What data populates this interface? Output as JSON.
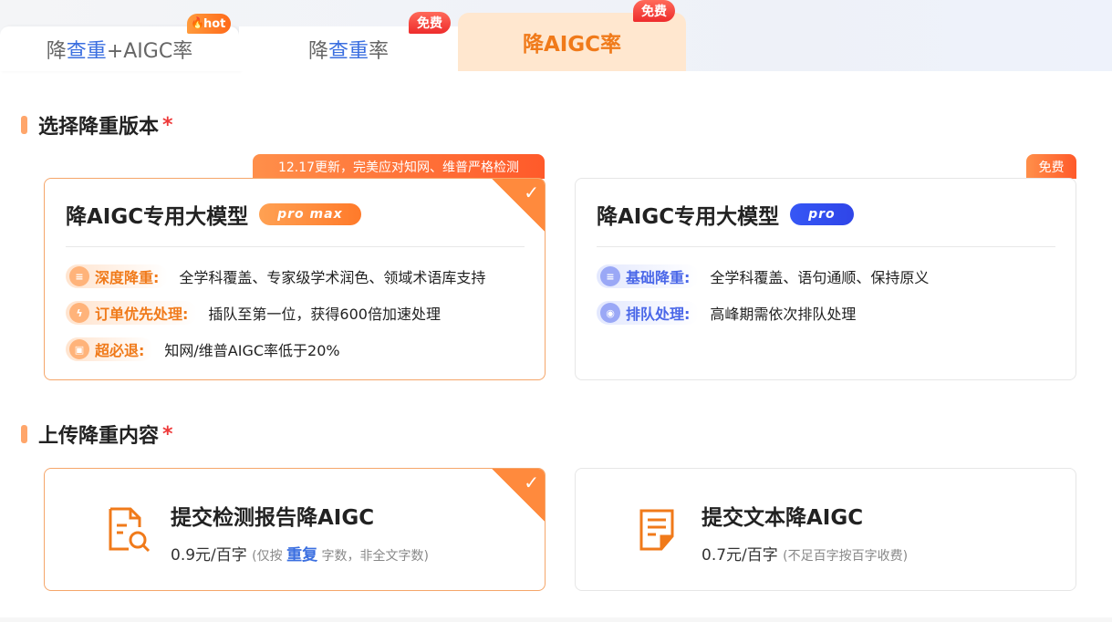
{
  "tabs": {
    "t1": {
      "p1": "降",
      "p2": "查重",
      "p3": "+AIGC率",
      "badge": "hot"
    },
    "t2": {
      "p1": "降",
      "p2": "查重",
      "p3": "率",
      "badge": "免费"
    },
    "t3": {
      "label": "降AIGC率",
      "badge": "免费"
    }
  },
  "section_version": {
    "title": "选择降重版本",
    "star": "*"
  },
  "card_promax": {
    "ribbon": "12.17更新，完美应对知网、维普严格检测",
    "title": "降AIGC专用大模型",
    "pill": "pro max",
    "features": [
      {
        "label": "深度降重:",
        "desc": "全学科覆盖、专家级学术润色、领域术语库支持",
        "icon": "layers-icon"
      },
      {
        "label": "订单优先处理:",
        "desc": "插队至第一位，获得600倍加速处理",
        "icon": "lightning-icon"
      },
      {
        "label": "超必退:",
        "desc": "知网/维普AIGC率低于20%",
        "icon": "wallet-icon"
      }
    ]
  },
  "card_pro": {
    "ribbon": "免费",
    "title": "降AIGC专用大模型",
    "pill": "pro",
    "features": [
      {
        "label": "基础降重:",
        "desc": "全学科覆盖、语句通顺、保持原义",
        "icon": "layers-icon"
      },
      {
        "label": "排队处理:",
        "desc": "高峰期需依次排队处理",
        "icon": "queue-icon"
      }
    ]
  },
  "section_upload": {
    "title": "上传降重内容",
    "star": "*"
  },
  "upload_report": {
    "title": "提交检测报告降AIGC",
    "price": "0.9元/百字",
    "note_pre": "(仅按",
    "note_hl": "重复",
    "note_post": "字数，非全文字数)"
  },
  "upload_text": {
    "title": "提交文本降AIGC",
    "price": "0.7元/百字",
    "note": "(不足百字按百字收费)"
  },
  "colors": {
    "accent": "#f07a1a",
    "blue": "#3b6fe0",
    "red": "#ee2c2c"
  }
}
